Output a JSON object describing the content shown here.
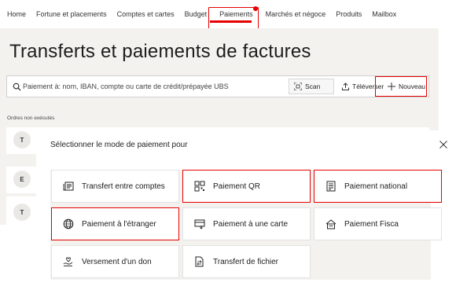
{
  "nav": {
    "items": [
      "Home",
      "Fortune et placements",
      "Comptes et cartes",
      "Budget",
      "Paiements",
      "Marchés et négoce",
      "Produits",
      "Mailbox"
    ],
    "active_index": 4
  },
  "page": {
    "title": "Transferts et paiements de factures"
  },
  "search": {
    "placeholder": "Paiement à: nom, IBAN, compte ou carte de crédit/prépayée UBS",
    "scan_label": "Scan",
    "upload_label": "Téléverser",
    "new_label": "Nouveau"
  },
  "orders": {
    "label": "Ordres non exécutés",
    "rows": [
      {
        "initial": "T"
      },
      {
        "initial": "E"
      },
      {
        "initial": "T"
      }
    ]
  },
  "modal": {
    "title": "Sélectionner le mode de paiement pour",
    "options": [
      {
        "label": "Transfert entre comptes",
        "icon": "account-transfer-icon"
      },
      {
        "label": "Paiement QR",
        "icon": "qr-code-icon"
      },
      {
        "label": "Paiement national",
        "icon": "national-payment-icon"
      },
      {
        "label": "Paiement à l'étranger",
        "icon": "globe-icon"
      },
      {
        "label": "Paiement à une carte",
        "icon": "card-payment-icon"
      },
      {
        "label": "Paiement Fisca",
        "icon": "tax-payment-icon"
      },
      {
        "label": "Versement d'un don",
        "icon": "donation-icon"
      },
      {
        "label": "Transfert de fichier",
        "icon": "file-transfer-icon"
      }
    ]
  },
  "colors": {
    "accent": "#e60000",
    "background": "#f3f2ef"
  }
}
